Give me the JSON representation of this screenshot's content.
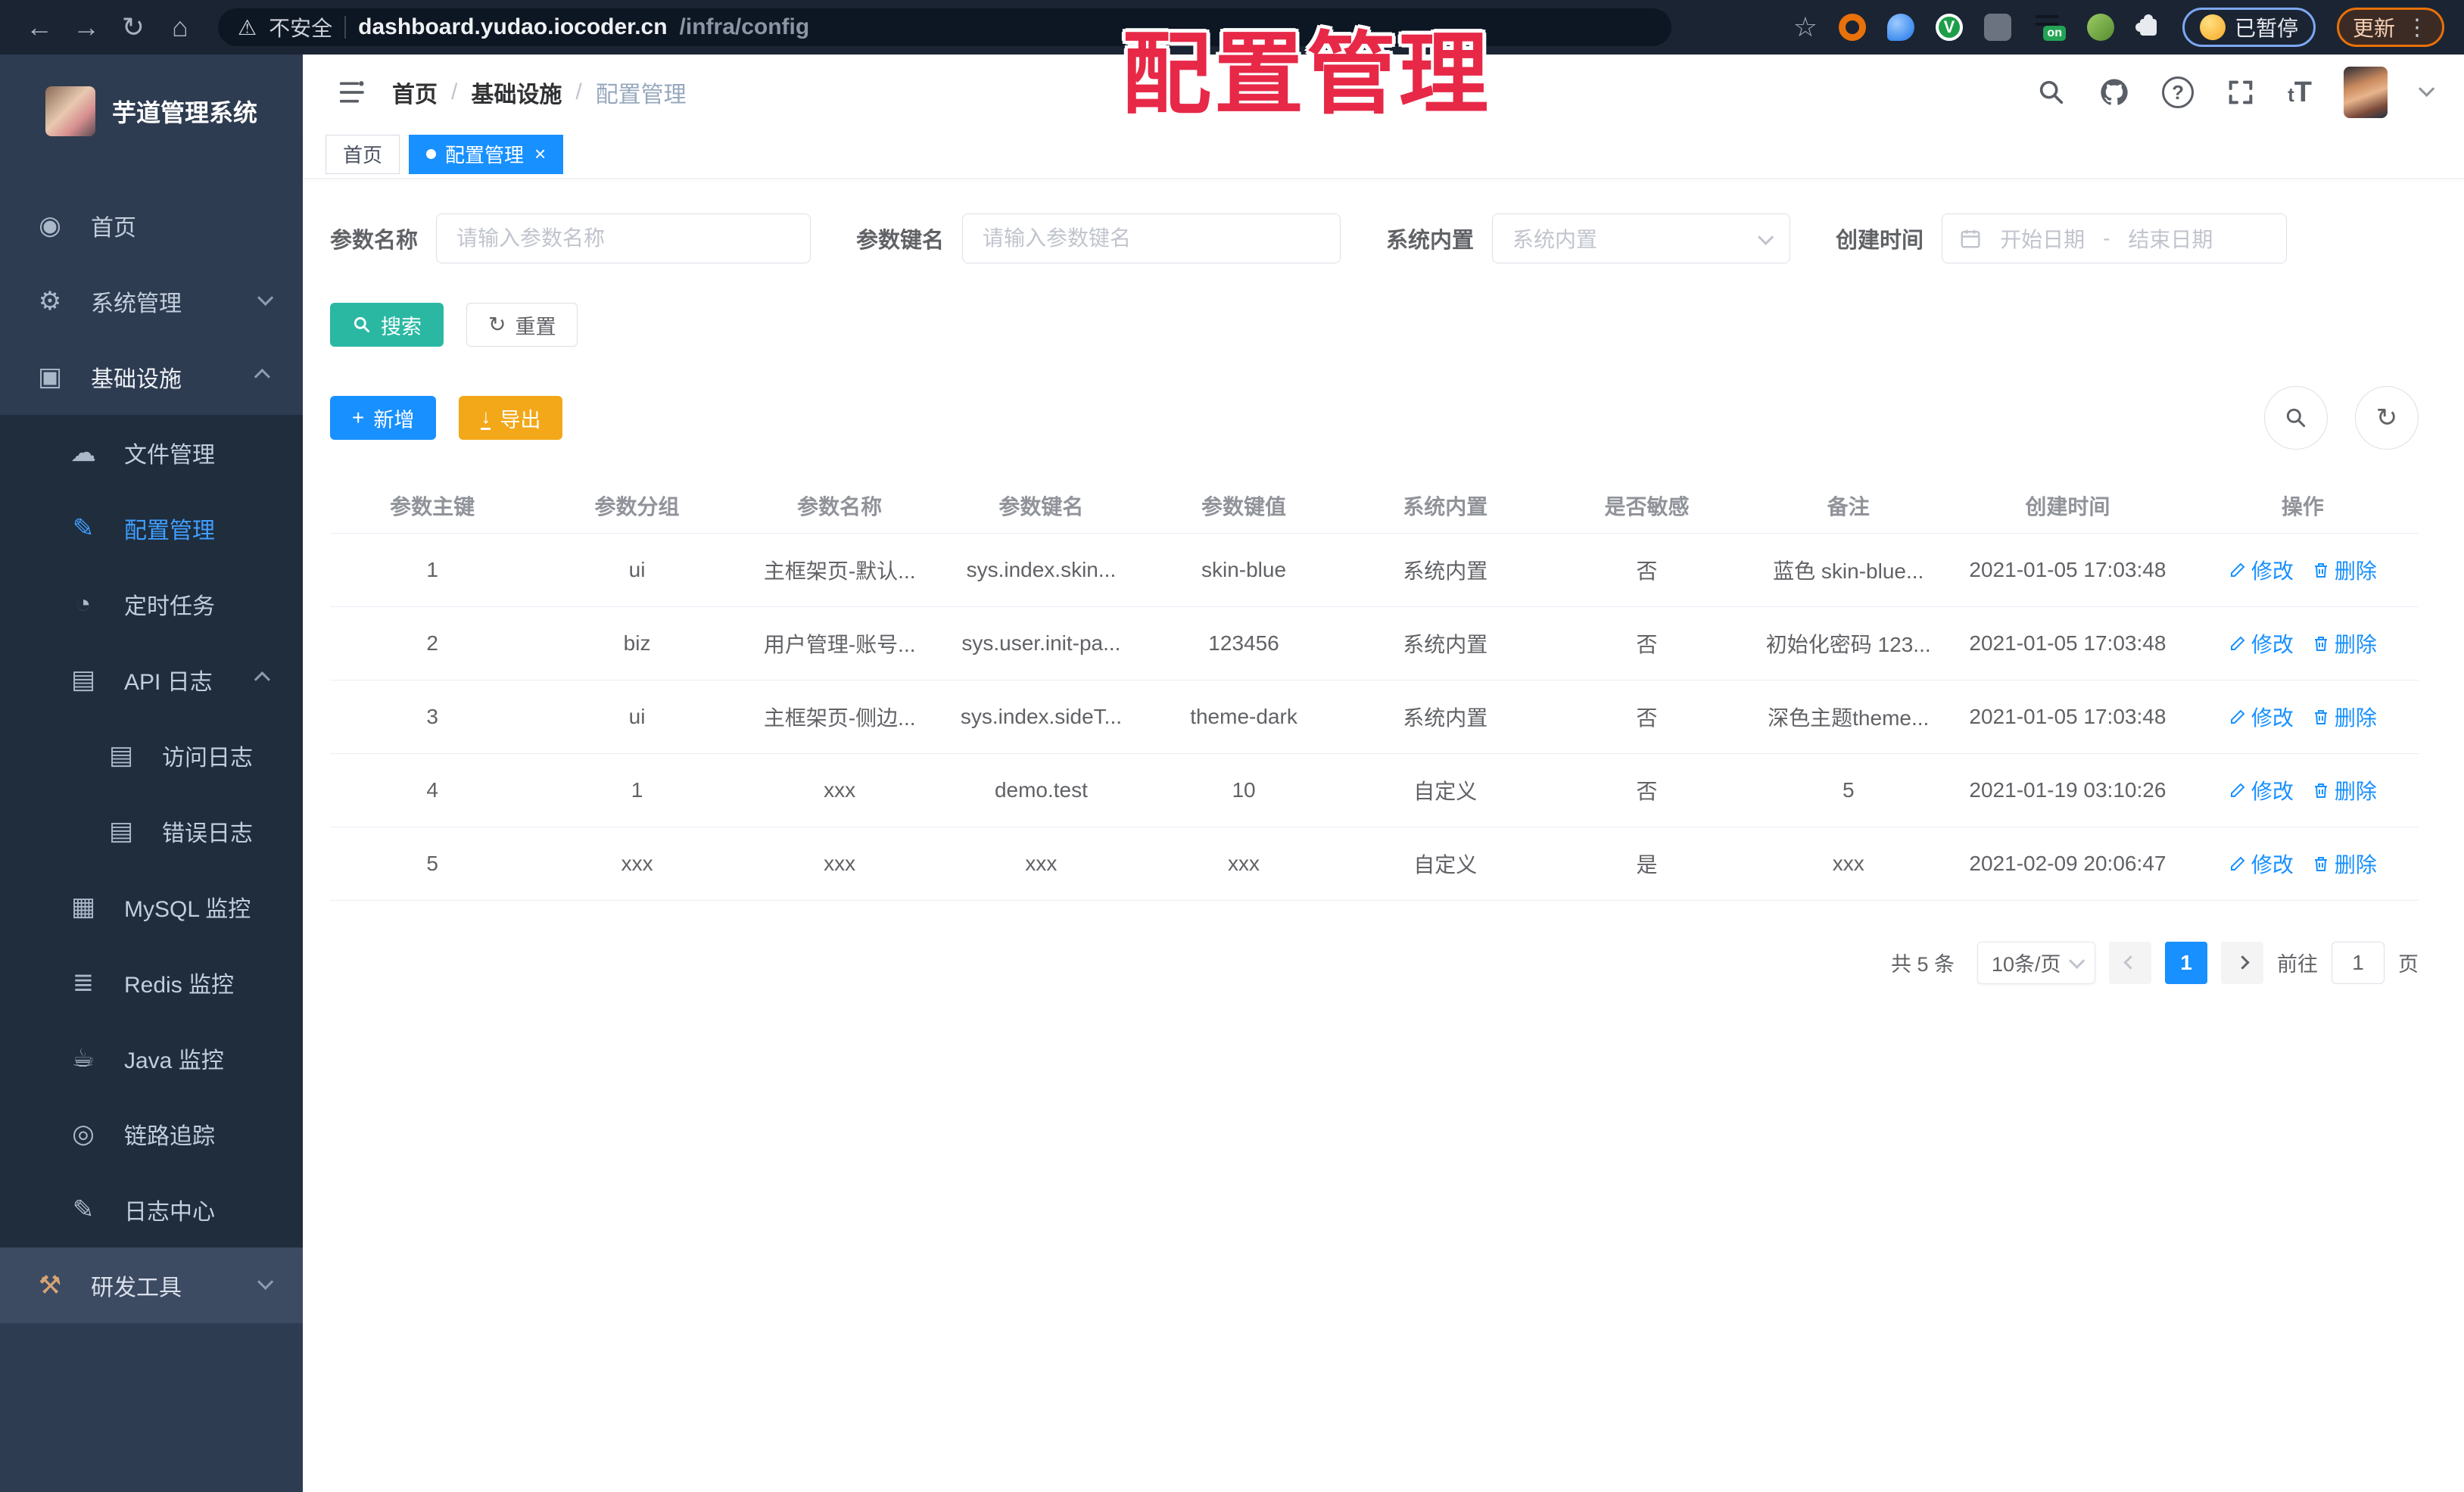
{
  "icons": {
    "back": "←",
    "forward": "→",
    "reload": "↻",
    "home": "⌂",
    "warning": "⚠",
    "star": "☆",
    "close": "×",
    "slash": "/",
    "refresh": "↻",
    "plus": "+",
    "download": "↓",
    "search_tool": "⌕",
    "dashboard": "◉",
    "gear": "⚙",
    "monitor": "▣",
    "cloud": "☁",
    "edit": "✎",
    "timer": "◔",
    "doc": "▤",
    "grid": "▦",
    "stack": "≣",
    "coffee": "☕",
    "eye": "◎",
    "tools": "⚒",
    "ext_v": "V",
    "dots": "⋮"
  },
  "browser": {
    "security_label": "不安全",
    "url_host": "dashboard.yudao.iocoder.cn",
    "url_path": "/infra/config",
    "paused_label": "已暂停",
    "update_label": "更新",
    "ext_on_badge": "on"
  },
  "watermark": "配置管理",
  "sidebar": {
    "app_title": "芋道管理系统",
    "items": {
      "home": "首页",
      "system": "系统管理",
      "infra": "基础设施",
      "file": "文件管理",
      "config": "配置管理",
      "job": "定时任务",
      "api_log": "API 日志",
      "access_log": "访问日志",
      "error_log": "错误日志",
      "mysql": "MySQL 监控",
      "redis": "Redis 监控",
      "java": "Java 监控",
      "trace": "链路追踪",
      "log_center": "日志中心",
      "dev_tools": "研发工具"
    }
  },
  "header": {
    "breadcrumb": {
      "home": "首页",
      "section": "基础设施",
      "page": "配置管理",
      "separator": "/"
    },
    "font_icon_small": "t",
    "font_icon_big": "T",
    "help_mark": "?"
  },
  "tabs": {
    "home": "首页",
    "active": "配置管理"
  },
  "search": {
    "name_label": "参数名称",
    "name_placeholder": "请输入参数名称",
    "key_label": "参数键名",
    "key_placeholder": "请输入参数键名",
    "builtin_label": "系统内置",
    "builtin_placeholder": "系统内置",
    "time_label": "创建时间",
    "date_start": "开始日期",
    "date_sep": "-",
    "date_end": "结束日期"
  },
  "buttons": {
    "search": "搜索",
    "reset": "重置",
    "add": "新增",
    "export": "导出"
  },
  "table": {
    "columns": [
      {
        "key": "id",
        "label": "参数主键"
      },
      {
        "key": "group",
        "label": "参数分组"
      },
      {
        "key": "name",
        "label": "参数名称"
      },
      {
        "key": "pkey",
        "label": "参数键名"
      },
      {
        "key": "value",
        "label": "参数键值"
      },
      {
        "key": "builtin",
        "label": "系统内置"
      },
      {
        "key": "sensitive",
        "label": "是否敏感"
      },
      {
        "key": "remark",
        "label": "备注"
      },
      {
        "key": "created",
        "label": "创建时间"
      },
      {
        "key": "actions",
        "label": "操作"
      }
    ],
    "edit_label": "修改",
    "delete_label": "删除",
    "rows": [
      {
        "id": "1",
        "group": "ui",
        "name": "主框架页-默认...",
        "pkey": "sys.index.skin...",
        "value": "skin-blue",
        "builtin": "系统内置",
        "sensitive": "否",
        "remark": "蓝色 skin-blue...",
        "created": "2021-01-05 17:03:48"
      },
      {
        "id": "2",
        "group": "biz",
        "name": "用户管理-账号...",
        "pkey": "sys.user.init-pa...",
        "value": "123456",
        "builtin": "系统内置",
        "sensitive": "否",
        "remark": "初始化密码 123...",
        "created": "2021-01-05 17:03:48"
      },
      {
        "id": "3",
        "group": "ui",
        "name": "主框架页-侧边...",
        "pkey": "sys.index.sideT...",
        "value": "theme-dark",
        "builtin": "系统内置",
        "sensitive": "否",
        "remark": "深色主题theme...",
        "created": "2021-01-05 17:03:48"
      },
      {
        "id": "4",
        "group": "1",
        "name": "xxx",
        "pkey": "demo.test",
        "value": "10",
        "builtin": "自定义",
        "sensitive": "否",
        "remark": "5",
        "created": "2021-01-19 03:10:26"
      },
      {
        "id": "5",
        "group": "xxx",
        "name": "xxx",
        "pkey": "xxx",
        "value": "xxx",
        "builtin": "自定义",
        "sensitive": "是",
        "remark": "xxx",
        "created": "2021-02-09 20:06:47"
      }
    ]
  },
  "pagination": {
    "total": "共 5 条",
    "page_size": "10条/页",
    "current_page": "1",
    "goto_label": "前往",
    "goto_value": "1",
    "page_unit": "页"
  }
}
